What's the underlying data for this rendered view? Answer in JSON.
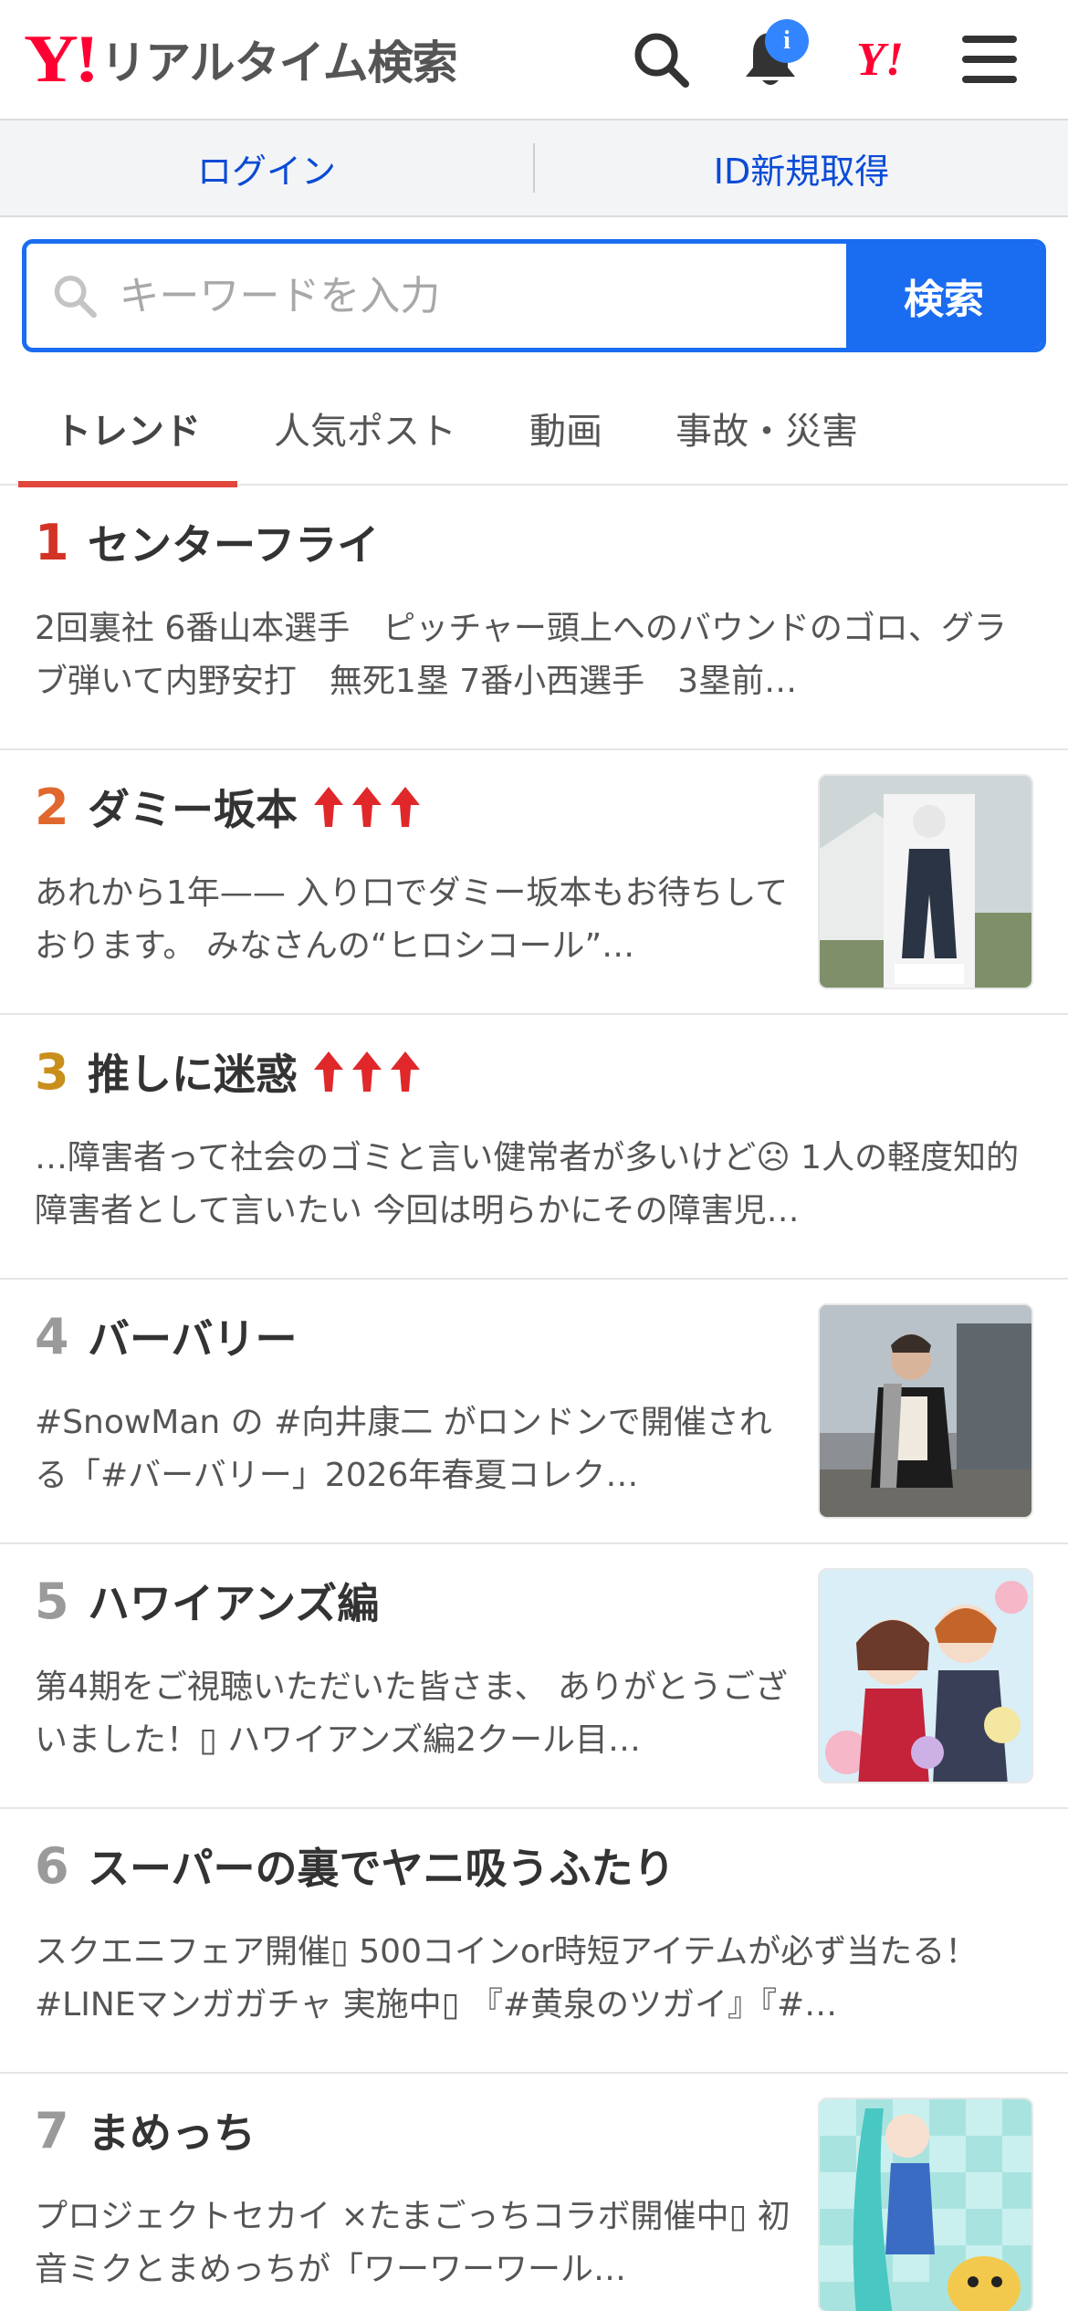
{
  "header": {
    "logo_mark": "Y!",
    "logo_text": "リアルタイム検索",
    "notification_badge": "i",
    "yahoo_link": "Y!"
  },
  "login_bar": {
    "login": "ログイン",
    "register": "ID新規取得"
  },
  "search": {
    "placeholder": "キーワードを入力",
    "button": "検索"
  },
  "tabs": [
    "トレンド",
    "人気ポスト",
    "動画",
    "事故・災害"
  ],
  "trends": [
    {
      "rank": "1",
      "title": "センターフライ",
      "desc": "2回裏社 6番山本選手　ピッチャー頭上へのバウンドのゴロ、グラブ弾いて内野安打　無死1塁 7番小西選手　3塁前…"
    },
    {
      "rank": "2",
      "title": "ダミー坂本",
      "desc": "あれから1年—— 入り口でダミー坂本もお待ちしております。 みなさんの“ヒロシコール”…"
    },
    {
      "rank": "3",
      "title": "推しに迷惑",
      "desc": "…障害者って社会のゴミと言い健常者が多いけど☹ 1人の軽度知的障害者として言いたい 今回は明らかにその障害児…"
    },
    {
      "rank": "4",
      "title": "バーバリー",
      "desc": "#SnowMan の #向井康二 がロンドンで開催される「#バーバリー」2026年春夏コレク…"
    },
    {
      "rank": "5",
      "title": "ハワイアンズ編",
      "desc": "第4期をご視聴いただいた皆さま、 ありがとうございました！▯ ハワイアンズ編2クール目…"
    },
    {
      "rank": "6",
      "title": "スーパーの裏でヤニ吸うふたり",
      "desc": "スクエニフェア開催▯ 500コインor時短アイテムが必ず当たる！ #LINEマンガガチャ 実施中▯ 『#黄泉のツガイ』『#…"
    },
    {
      "rank": "7",
      "title": "まめっち",
      "desc": "プロジェクトセカイ ×たまごっちコラボ開催中▯ 初音ミクとまめっちが「ワーワーワール…"
    }
  ],
  "colors": {
    "accent": "#1a6cf0",
    "brand": "#ff0033",
    "tab_underline": "#e0463c",
    "rank1": "#d23325",
    "rank2": "#e0672d",
    "rank3": "#c98f1d",
    "rank_other": "#9a9a9a"
  }
}
